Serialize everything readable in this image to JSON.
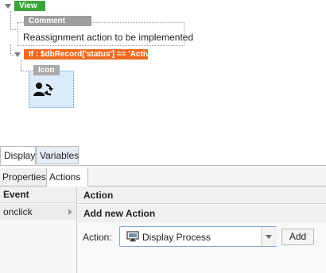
{
  "tree": {
    "view_label": "View",
    "comment_label": "Comment",
    "comment_text": "Reassignment action to be implemented",
    "if_label": "If : $dbRecord['status'] == 'Active'",
    "icon_label": "Icon",
    "icon_symbol": "user-swap-icon"
  },
  "tabs": {
    "display": "Display",
    "variables": "Variables"
  },
  "subtabs": {
    "properties": "Properties",
    "actions": "Actions"
  },
  "events": {
    "header": "Event",
    "items": [
      "onclick"
    ]
  },
  "actions_panel": {
    "header": "Action",
    "subheader": "Add new Action",
    "action_label": "Action:",
    "selected_action": "Display Process",
    "add_label": "Add"
  },
  "colors": {
    "view_tag": "#3aa63a",
    "comment_tag": "#9e9e9e",
    "if_tag": "#f06a1e",
    "icon_tag": "#a9a9a9",
    "icon_bg": "#dcebfb",
    "select_border": "#7aa7d9"
  }
}
